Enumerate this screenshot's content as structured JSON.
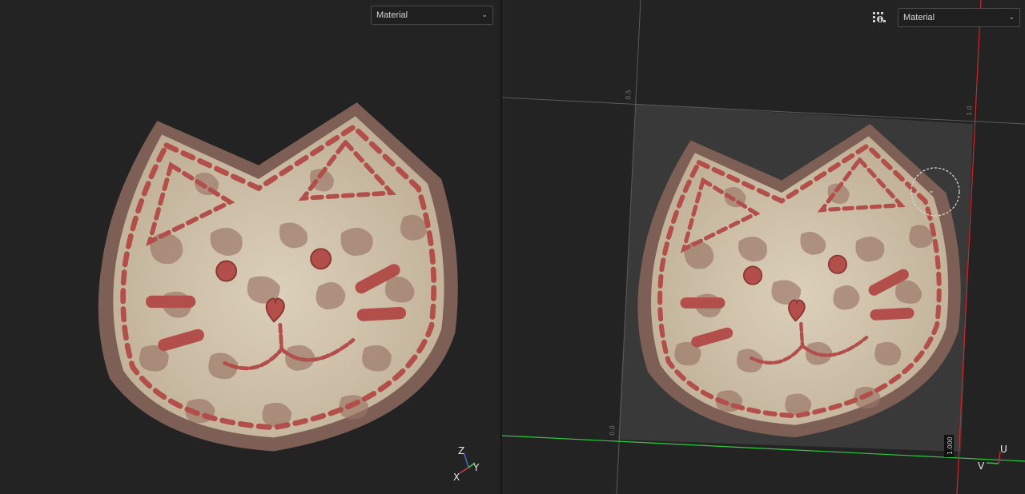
{
  "viewport_3d": {
    "shading_mode": "Material",
    "gizmo_axes": {
      "z": "Z",
      "y": "Y",
      "x": "X"
    }
  },
  "viewport_uv": {
    "shading_mode": "Material",
    "ruler_labels": {
      "top_left": "0.5",
      "top_right": "1.0",
      "bottom_left": "0.0",
      "bottom_right": "1.000"
    },
    "gizmo_axes": {
      "u": "U",
      "v": "V"
    }
  },
  "icons": {
    "dropdown": "chevron-down-icon",
    "tool": "uv-tool-icon",
    "brush": "brush-cursor-icon"
  },
  "colors": {
    "background": "#232323",
    "patch_fabric": "#cdbfa6",
    "stitch": "#b24f4a",
    "axis_u": "#d0252a",
    "axis_v": "#2ecc40"
  }
}
